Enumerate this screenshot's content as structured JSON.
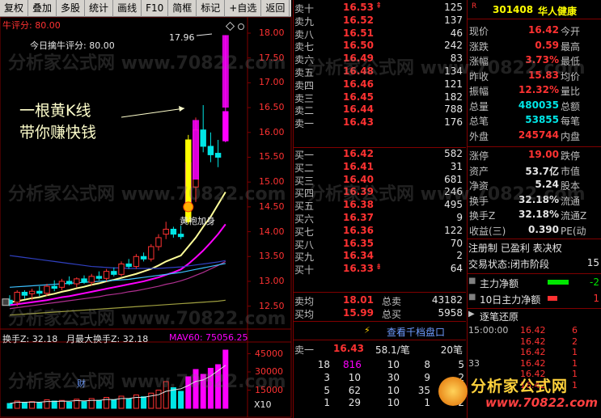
{
  "toolbar": [
    "复权",
    "叠加",
    "多股",
    "统计",
    "画线",
    "F10",
    "简框",
    "标记",
    "+自选",
    "返回"
  ],
  "chart": {
    "indicator_label": "牛评分: 80.00",
    "today_label": "今日擒牛评分: 80.00",
    "max_price_label": "17.96",
    "annotation_line1": "一根黄K线",
    "annotation_line2": "带你赚快钱",
    "annotation2": "黄袍加身",
    "price_ticks": [
      "18.00",
      "17.50",
      "17.00",
      "16.50",
      "16.00",
      "15.50",
      "15.00",
      "14.50",
      "14.00",
      "13.50",
      "13.00",
      "12.50"
    ],
    "volume_header_a": "换手Z: 32.18",
    "volume_header_b": "月最大换手Z: 32.18",
    "volume_header_c": "MAV60: 75056.25",
    "vol_ticks": [
      "45000",
      "30000",
      "15000"
    ],
    "vol_unit": "X10",
    "cai_label": "财",
    "candles": [
      {
        "o": 12.62,
        "h": 12.72,
        "l": 12.5,
        "c": 12.55
      },
      {
        "o": 12.58,
        "h": 12.82,
        "l": 12.5,
        "c": 12.78
      },
      {
        "o": 12.78,
        "h": 12.82,
        "l": 12.65,
        "c": 12.72
      },
      {
        "o": 12.75,
        "h": 12.85,
        "l": 12.62,
        "c": 12.8
      },
      {
        "o": 12.8,
        "h": 12.9,
        "l": 12.7,
        "c": 12.76
      },
      {
        "o": 12.76,
        "h": 12.95,
        "l": 12.7,
        "c": 12.9
      },
      {
        "o": 12.9,
        "h": 13.02,
        "l": 12.8,
        "c": 12.86
      },
      {
        "o": 12.88,
        "h": 13.05,
        "l": 12.82,
        "c": 13.0
      },
      {
        "o": 13.0,
        "h": 13.1,
        "l": 12.92,
        "c": 12.95
      },
      {
        "o": 12.95,
        "h": 13.08,
        "l": 12.88,
        "c": 13.05
      },
      {
        "o": 13.05,
        "h": 13.12,
        "l": 12.95,
        "c": 12.98
      },
      {
        "o": 12.98,
        "h": 13.15,
        "l": 12.92,
        "c": 13.1
      },
      {
        "o": 13.1,
        "h": 13.2,
        "l": 13.02,
        "c": 13.06
      },
      {
        "o": 13.06,
        "h": 13.25,
        "l": 13.0,
        "c": 13.2
      },
      {
        "o": 13.2,
        "h": 13.28,
        "l": 13.1,
        "c": 13.14
      },
      {
        "o": 13.14,
        "h": 13.4,
        "l": 13.1,
        "c": 13.35
      },
      {
        "o": 13.35,
        "h": 13.45,
        "l": 13.25,
        "c": 13.3
      },
      {
        "o": 13.3,
        "h": 13.55,
        "l": 13.25,
        "c": 13.5
      },
      {
        "o": 13.5,
        "h": 13.58,
        "l": 13.4,
        "c": 13.45
      },
      {
        "o": 13.45,
        "h": 13.75,
        "l": 13.4,
        "c": 13.7
      },
      {
        "o": 13.7,
        "h": 13.95,
        "l": 13.62,
        "c": 13.88
      },
      {
        "o": 13.95,
        "h": 14.2,
        "l": 13.85,
        "c": 14.05
      },
      {
        "o": 14.05,
        "h": 14.1,
        "l": 13.88,
        "c": 13.95
      },
      {
        "o": 13.95,
        "h": 14.12,
        "l": 13.85,
        "c": 13.9
      },
      {
        "o": 14.2,
        "h": 15.95,
        "l": 14.15,
        "c": 15.85
      },
      {
        "o": 14.9,
        "h": 16.3,
        "l": 14.6,
        "c": 16.05
      },
      {
        "o": 16.05,
        "h": 16.55,
        "l": 15.6,
        "c": 15.72
      },
      {
        "o": 15.72,
        "h": 16.0,
        "l": 15.4,
        "c": 15.55
      },
      {
        "o": 15.58,
        "h": 15.85,
        "l": 15.3,
        "c": 15.5
      },
      {
        "o": 15.83,
        "h": 17.96,
        "l": 15.8,
        "c": 16.42
      }
    ],
    "ma_series": [
      {
        "name": "MA1",
        "color": "#ffff99",
        "values": [
          12.58,
          12.6,
          12.63,
          12.66,
          12.68,
          12.72,
          12.75,
          12.79,
          12.82,
          12.86,
          12.89,
          12.93,
          12.96,
          13.0,
          13.03,
          13.07,
          13.11,
          13.15,
          13.2,
          13.25,
          13.32,
          13.4,
          13.46,
          13.52,
          13.7,
          13.88,
          14.1,
          14.3,
          14.55,
          14.8
        ]
      },
      {
        "name": "MA2",
        "color": "#ff00ff",
        "values": [
          12.52,
          12.54,
          12.56,
          12.58,
          12.6,
          12.62,
          12.65,
          12.68,
          12.7,
          12.73,
          12.76,
          12.79,
          12.82,
          12.85,
          12.88,
          12.91,
          12.94,
          12.97,
          13.0,
          13.04,
          13.08,
          13.13,
          13.18,
          13.24,
          13.35,
          13.48,
          13.62,
          13.78,
          13.95,
          14.15
        ]
      },
      {
        "name": "MA3",
        "color": "#b03090",
        "values": [
          12.45,
          12.47,
          12.49,
          12.51,
          12.53,
          12.55,
          12.57,
          12.59,
          12.61,
          12.63,
          12.65,
          12.67,
          12.69,
          12.72,
          12.74,
          12.76,
          12.79,
          12.81,
          12.84,
          12.87,
          12.9,
          12.94,
          12.97,
          13.01,
          13.06,
          13.12,
          13.18,
          13.25,
          13.32,
          13.4
        ]
      },
      {
        "name": "MA4",
        "color": "#3cc0ff",
        "values": [
          12.88,
          12.89,
          12.9,
          12.91,
          12.92,
          12.93,
          12.94,
          12.95,
          12.96,
          12.97,
          12.98,
          12.99,
          13.0,
          13.01,
          13.02,
          13.03,
          13.04,
          13.06,
          13.08,
          13.1,
          13.12,
          13.14,
          13.16,
          13.18,
          13.21,
          13.24,
          13.27,
          13.3,
          13.33,
          13.36
        ]
      },
      {
        "name": "MA5",
        "color": "#3040c0",
        "values": [
          13.52,
          13.5,
          13.48,
          13.46,
          13.44,
          13.42,
          13.4,
          13.38,
          13.36,
          13.34,
          13.32,
          13.3,
          13.29,
          13.28,
          13.27,
          13.27,
          13.26,
          13.26,
          13.26,
          13.26,
          13.26,
          13.27,
          13.28,
          13.29,
          13.31,
          13.33,
          13.35,
          13.37,
          13.39,
          13.42
        ]
      },
      {
        "name": "MA6",
        "color": "#a0a040",
        "values": [
          12.32,
          12.33,
          12.34,
          12.35,
          12.36,
          12.37,
          12.38,
          12.39,
          12.4,
          12.41,
          12.42,
          12.43,
          12.44,
          12.45,
          12.46,
          12.47,
          12.48,
          12.49,
          12.5,
          12.51,
          12.52,
          12.53,
          12.54,
          12.55,
          12.56,
          12.57,
          12.58,
          12.59,
          12.6,
          12.62
        ]
      }
    ],
    "volumes": [
      4000,
      6000,
      5000,
      5500,
      4500,
      7000,
      6000,
      6500,
      5000,
      7500,
      5500,
      8000,
      6500,
      9000,
      7000,
      10000,
      8000,
      11000,
      9500,
      12500,
      15000,
      22000,
      17000,
      14000,
      26000,
      32000,
      28000,
      33000,
      36000,
      48000
    ]
  },
  "book": {
    "sell": [
      {
        "label": "卖十",
        "price": "16.53",
        "mark": "⇞",
        "vol": "125"
      },
      {
        "label": "卖九",
        "price": "16.52",
        "mark": "",
        "vol": "137"
      },
      {
        "label": "卖八",
        "price": "16.51",
        "mark": "",
        "vol": "46"
      },
      {
        "label": "卖七",
        "price": "16.50",
        "mark": "",
        "vol": "242"
      },
      {
        "label": "卖六",
        "price": "16.49",
        "mark": "",
        "vol": "83"
      },
      {
        "label": "卖五",
        "price": "16.48",
        "mark": "",
        "vol": "134"
      },
      {
        "label": "卖四",
        "price": "16.46",
        "mark": "",
        "vol": "121"
      },
      {
        "label": "卖三",
        "price": "16.45",
        "mark": "",
        "vol": "182"
      },
      {
        "label": "卖二",
        "price": "16.44",
        "mark": "",
        "vol": "788"
      },
      {
        "label": "卖一",
        "price": "16.43",
        "mark": "",
        "vol": "176"
      }
    ],
    "buy": [
      {
        "label": "买一",
        "price": "16.42",
        "mark": "",
        "vol": "582"
      },
      {
        "label": "买二",
        "price": "16.41",
        "mark": "",
        "vol": "31"
      },
      {
        "label": "买三",
        "price": "16.40",
        "mark": "",
        "vol": "681"
      },
      {
        "label": "买四",
        "price": "16.39",
        "mark": "",
        "vol": "246"
      },
      {
        "label": "买五",
        "price": "16.38",
        "mark": "",
        "vol": "495"
      },
      {
        "label": "买六",
        "price": "16.37",
        "mark": "",
        "vol": "9"
      },
      {
        "label": "买七",
        "price": "16.36",
        "mark": "",
        "vol": "122"
      },
      {
        "label": "买八",
        "price": "16.35",
        "mark": "",
        "vol": "70"
      },
      {
        "label": "买九",
        "price": "16.34",
        "mark": "",
        "vol": "2"
      },
      {
        "label": "买十",
        "price": "16.33",
        "mark": "⇟",
        "vol": "64"
      }
    ],
    "avg": [
      {
        "label": "卖均",
        "price": "18.01",
        "tlabel": "总卖",
        "total": "43182"
      },
      {
        "label": "买均",
        "price": "15.99",
        "tlabel": "总买",
        "total": "5958"
      }
    ],
    "link": "查看千档盘口",
    "last_label": "卖一",
    "last_price": "16.43",
    "last_qty": "58.1/笔",
    "last_count": "20笔",
    "grid": [
      [
        "18",
        "816",
        "10",
        "8",
        "5"
      ],
      [
        "3",
        "10",
        "30",
        "9",
        "2"
      ],
      [
        "5",
        "62",
        "10",
        "35",
        "2"
      ],
      [
        "1",
        "29",
        "10",
        "1",
        "2"
      ]
    ]
  },
  "rp": {
    "code": "301408",
    "name": "华人健康",
    "rows": [
      {
        "a": "现价",
        "b": "16.42",
        "c": "今开"
      },
      {
        "a": "涨跌",
        "b": "0.59",
        "c": "最高"
      },
      {
        "a": "涨幅",
        "b": "3.73%",
        "c": "最低"
      },
      {
        "a": "昨收",
        "b": "15.83",
        "c": "均价"
      },
      {
        "a": "振幅",
        "b": "12.32%",
        "c": "量比"
      },
      {
        "a": "总量",
        "b": "480035",
        "c": "总额"
      },
      {
        "a": "总笔",
        "b": "53855",
        "c": "每笔"
      },
      {
        "a": "外盘",
        "b": "245744",
        "c": "内盘"
      }
    ],
    "rows2": [
      {
        "a": "涨停",
        "b": "19.00",
        "c": "跌停"
      },
      {
        "a": "资产",
        "b": "53.7亿",
        "c": "市值"
      },
      {
        "a": "净资",
        "b": "5.24",
        "c": "股本"
      },
      {
        "a": "换手",
        "b": "32.18%",
        "c": "流通"
      },
      {
        "a": "换手Z",
        "b": "32.18%",
        "c": "流通Z"
      },
      {
        "a": "收益(三)",
        "b": "0.390",
        "c": "PE(动"
      }
    ],
    "status1": "注册制 已盈利 表决权",
    "status2": "交易状态:闭市阶段",
    "status2_num": "15",
    "flow1": "主力净额",
    "flow1_val": "-2",
    "flow2": "10日主力净额",
    "flow2_val": "1",
    "ticks_title": "逐笔还原",
    "ticks": [
      {
        "t": "15:00:00",
        "p": "16.42",
        "v": "6"
      },
      {
        "t": "",
        "p": "16.42",
        "v": "2"
      },
      {
        "t": "",
        "p": "16.42",
        "v": "1"
      },
      {
        "t": "33",
        "p": "16.42",
        "v": "1"
      },
      {
        "t": "",
        "p": "16.42",
        "v": "1"
      },
      {
        "t": "",
        "p": "16.42",
        "v": "1"
      }
    ]
  },
  "watermark": "分析家公式网 www.70822.com",
  "logo_text": "分析家公式网",
  "logo_url": "www.70822.com"
}
